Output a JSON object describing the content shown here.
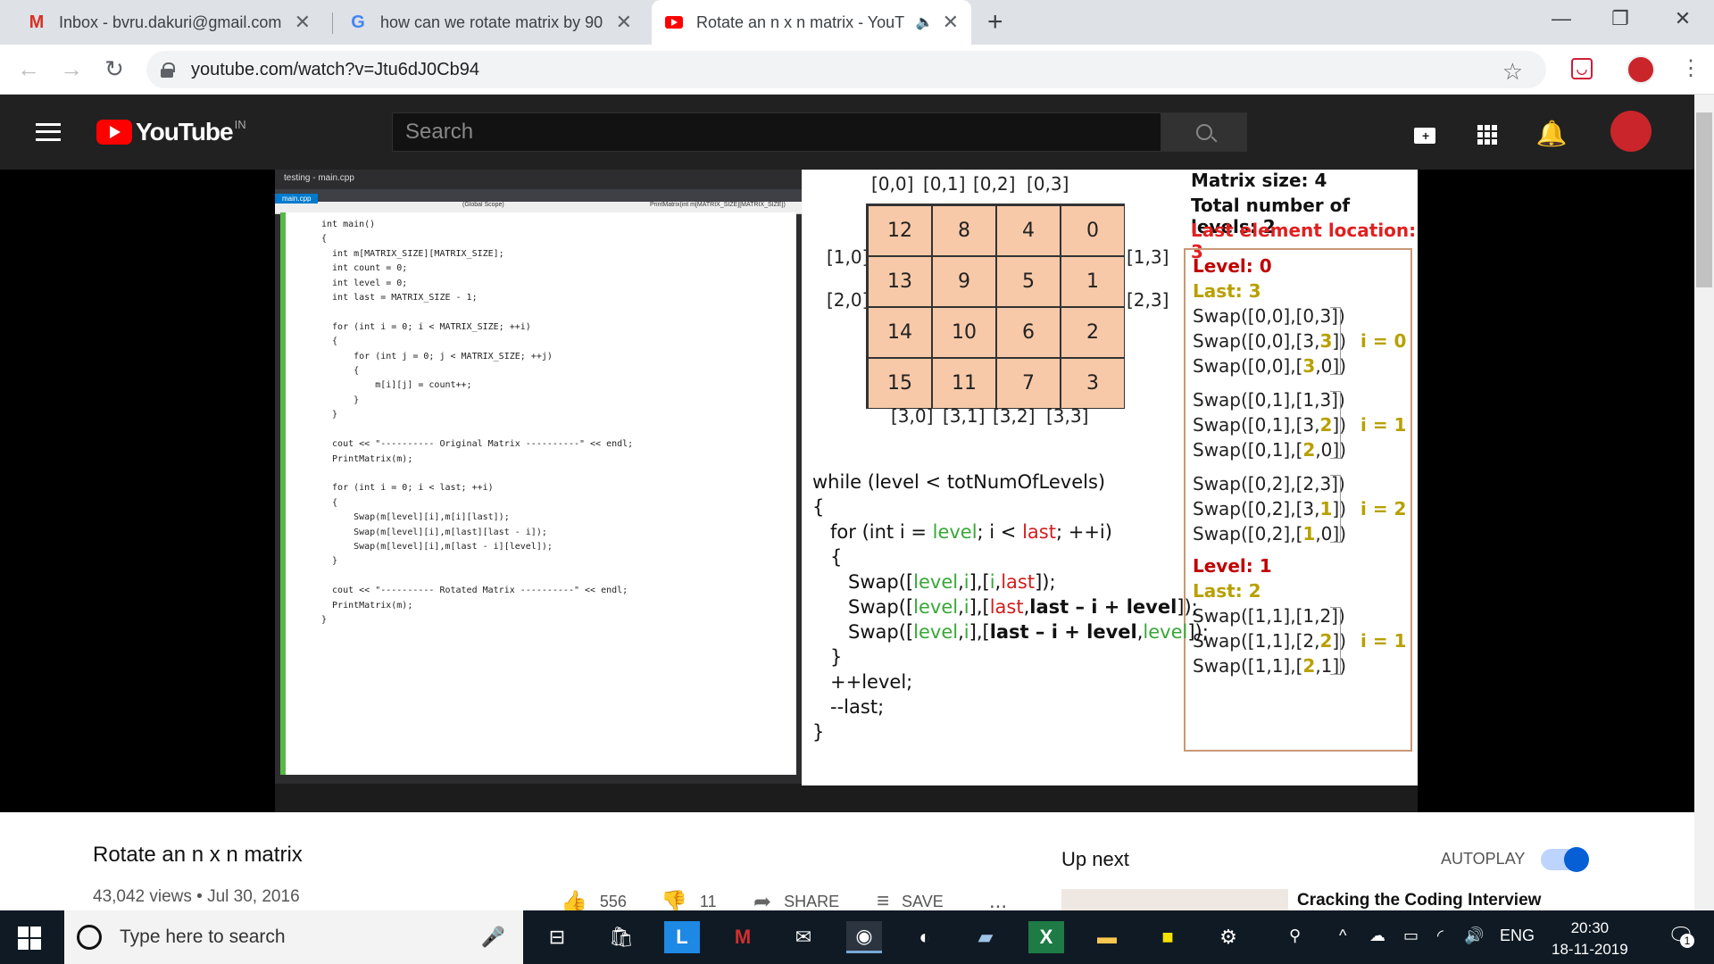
{
  "browser": {
    "tabs": [
      {
        "title": "Inbox - bvru.dakuri@gmail.com -",
        "icon": "gmail-icon"
      },
      {
        "title": "how can we rotate matrix by 90",
        "icon": "google-icon"
      },
      {
        "title": "Rotate an n x n matrix - YouT",
        "icon": "youtube-icon"
      }
    ],
    "url": "youtube.com/watch?v=Jtu6dJ0Cb94"
  },
  "youtube": {
    "region": "IN",
    "search_placeholder": "Search"
  },
  "video": {
    "title": "Rotate an n x n matrix",
    "meta": "43,042 views • Jul 30, 2016",
    "likes": "556",
    "dislikes": "11",
    "share": "SHARE",
    "save": "SAVE",
    "more": "..."
  },
  "sidebar": {
    "up_next": "Up next",
    "autoplay": "AUTOPLAY",
    "autoplay_on": true,
    "next_title": "Cracking the Coding Interview"
  },
  "slide": {
    "top_indices": [
      "[0,0]",
      "[0,1]",
      "[0,2]",
      "[0,3]"
    ],
    "bottom_indices": [
      "[3,0]",
      "[3,1]",
      "[3,2]",
      "[3,3]"
    ],
    "left_indices": [
      "[1,0]",
      "[2,0]"
    ],
    "right_indices": [
      "[1,3]",
      "[2,3]"
    ],
    "matrix": [
      [
        "12",
        "8",
        "4",
        "0"
      ],
      [
        "13",
        "9",
        "5",
        "1"
      ],
      [
        "14",
        "10",
        "6",
        "2"
      ],
      [
        "15",
        "11",
        "7",
        "3"
      ]
    ],
    "matrix_size": "Matrix size: 4",
    "total_levels": "Total number of levels: 2",
    "last_location": "Last element location: 3",
    "level0": "Level: 0",
    "last0": "Last: 3",
    "level1": "Level: 1",
    "last1": "Last: 2",
    "i0": "i = 0",
    "i1": "i = 1",
    "i2": "i = 2",
    "i3": "i = 1",
    "loop_while": "while (level < totNumOfLevels)",
    "loop_open": "{",
    "loop_for_pre": "for (int i = ",
    "loop_for_level": "level",
    "loop_for_mid": "; i < ",
    "loop_for_last": "last",
    "loop_for_end": "; ++i)",
    "loop_inner_open": "{",
    "loop_inner_close": "}",
    "loop_inc": "++level;",
    "loop_dec": "--last;",
    "loop_close": "}"
  },
  "ide": {
    "title": "testing - main.cpp",
    "file_tab": "main.cpp",
    "scope": "(Global Scope)",
    "function": "PrintMatrix(int m[MATRIX_SIZE][MATRIX_SIZE])",
    "code": "int main()\n{\n  int m[MATRIX_SIZE][MATRIX_SIZE];\n  int count = 0;\n  int level = 0;\n  int last = MATRIX_SIZE - 1;\n\n  for (int i = 0; i < MATRIX_SIZE; ++i)\n  {\n      for (int j = 0; j < MATRIX_SIZE; ++j)\n      {\n          m[i][j] = count++;\n      }\n  }\n\n  cout << \"---------- Original Matrix ----------\" << endl;\n  PrintMatrix(m);\n\n  for (int i = 0; i < last; ++i)\n  {\n      Swap(m[level][i],m[i][last]);\n      Swap(m[level][i],m[last][last - i]);\n      Swap(m[level][i],m[last - i][level]);\n  }\n\n  cout << \"---------- Rotated Matrix ----------\" << endl;\n  PrintMatrix(m);\n}"
  },
  "taskbar": {
    "search_placeholder": "Type here to search",
    "language": "ENG",
    "time": "20:30",
    "date": "18-11-2019",
    "notifications": "1"
  }
}
